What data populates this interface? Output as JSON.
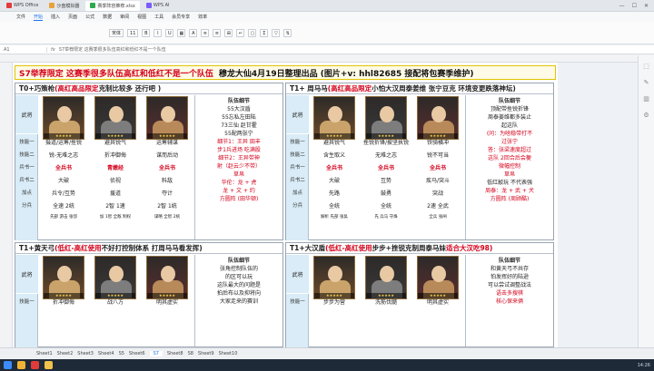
{
  "app": {
    "tabs": [
      {
        "label": "WPS Office",
        "active": false
      },
      {
        "label": "沙盘模拟器",
        "active": false
      },
      {
        "label": "赛季阵容推荐.xlsx",
        "active": true
      },
      {
        "label": "WPS AI",
        "active": false
      }
    ]
  },
  "menu": [
    "文件",
    "开始",
    "插入",
    "页面",
    "公式",
    "数据",
    "审阅",
    "视图",
    "工具",
    "会员专享",
    "效率"
  ],
  "menu_active": "开始",
  "toolbar": {
    "font": "宋体",
    "size": "11"
  },
  "formula": {
    "cellref": "A1",
    "content": "S7举荐限定 这赛季很多队伍高红和低红不是一个队伍"
  },
  "banner": {
    "part1": "S7举荐限定 这赛季很多队伍高红和低红不是一个队伍",
    "part2": "穆龙大仙4月19日整理出品  (图片+v:  hhl82685  接配将包赛季维护)"
  },
  "labels": [
    "技能一",
    "技能二",
    "兵书一",
    "兵书二",
    "加点",
    "分兵"
  ],
  "wj": "武将",
  "panels": [
    {
      "id": "tl",
      "title_a": "T0+巧策枪 ",
      "title_b": "(高红高品限定",
      "title_c": " 克制比较多 还行吧 )",
      "heroes": [
        {
          "s1": "摄道/运筹/挫锐",
          "s2": "锐-无难之志",
          "b1": "全兵书",
          "b2": "大破",
          "b3": "兵令/互势",
          "pt": "全速 2统",
          "sp": "先部 游击 张郃"
        },
        {
          "s1": "避其锐气",
          "s2": "折冲御侮",
          "b1": "青嫩经",
          "b2": "侦视",
          "b3": "援道",
          "pt": "2智 1速",
          "sp": "加 1智 全敌 制权"
        },
        {
          "s1": "运筹辅谋",
          "s2": "谋而后动",
          "b1": "全兵书",
          "b2": "料敌",
          "b3": "夺计",
          "pt": "2智 1统",
          "sp": "谋略 全智 2统"
        }
      ],
      "notes": [
        "队伍细节",
        "55大汉盾",
        "55忘私左田陆",
        "73三仙 赵甘霍",
        "55配两张宁",
        "细节1：王异 田丰",
        "步1兵进场 吃满股",
        "细节2：王异带神",
        "射（赵云少不带）",
        "草帛",
        "华伦：龙 + 虎",
        "龙 + 文 + 约",
        "方圆阵 (田华顿)"
      ]
    },
    {
      "id": "tr",
      "title_a": "T1+ 周马马",
      "title_b": "(高红高品限定",
      "title_c": " 小怕大汉周泰姜维 张宁豆克 环境变更跌落神坛)",
      "heroes": [
        {
          "s1": "避其锐气",
          "s2": "含生取义",
          "b1": "全兵书",
          "b2": "大破",
          "b3": "先路",
          "pt": "全统",
          "sp": "解析 先部 张奂"
        },
        {
          "s1": "挫锐折锋/披坚执锐",
          "s2": "无难之志",
          "b1": "全兵书",
          "b2": "互势",
          "b3": "鼓勇",
          "pt": "全统",
          "sp": "先 兵马 守烽"
        },
        {
          "s1": "铁骑横冲",
          "s2": "锐不可当",
          "b1": "全兵书",
          "b2": "疾马/突斗",
          "b3": "突战",
          "pt": "2速 全武",
          "sp": "全兵 张闸"
        }
      ],
      "notes": [
        "队伍细节",
        "顶配带挫锐折锋",
        "周泰姜维都多装止",
        "起这队",
        "(问：为啥稳带打不",
        "过张宁",
        "答：张梁速度超过",
        "这队 2回合后会梗",
        "微幅控制",
        "草帛",
        "低红敲玩 不代表强",
        "周泰：龙 + 武 + 犬",
        "方圆阵 (周顾酷)"
      ]
    },
    {
      "id": "bl",
      "title_a": "T1+黄天弓 ",
      "title_b": "(低红-高红使用",
      "title_c": " 不好打控制体系 打周马马看发挥)",
      "heroes": [
        {
          "s1": "折冲御侮",
          "s2": "",
          "b1": "",
          "b2": "",
          "b3": "",
          "pt": "",
          "sp": ""
        },
        {
          "s1": "战八方",
          "s2": "",
          "b1": "",
          "b2": "",
          "b3": "",
          "pt": "",
          "sp": ""
        },
        {
          "s1": "明其虚实",
          "s2": "",
          "b1": "",
          "b2": "",
          "b3": "",
          "pt": "",
          "sp": ""
        }
      ],
      "notes": [
        "队伍细节",
        "张角控制队伍的",
        "的区可以玩",
        "这队最大的问题是",
        "拍后布以及抑将向",
        "大家走来的赛训"
      ]
    },
    {
      "id": "br",
      "title_a": "T1+大汉盾 ",
      "title_b": "(低红-高红使用",
      "title_c": " 步步+挫锐克制周泰马妹",
      "title_d": " 适合大汉吃98)",
      "heroes": [
        {
          "s1": "步步为营",
          "s2": "",
          "b1": "",
          "b2": "",
          "b3": "",
          "pt": "",
          "sp": ""
        },
        {
          "s1": "洗筋伐髓",
          "s2": "",
          "b1": "",
          "b2": "",
          "b3": "",
          "pt": "",
          "sp": ""
        },
        {
          "s1": "明其虚实",
          "s2": "",
          "b1": "",
          "b2": "",
          "b3": "",
          "pt": "",
          "sp": ""
        }
      ],
      "notes": [
        "队伍细节",
        "和黄天弓不共存",
        "怕发挥好的陆逊",
        "可以尝试调整战法",
        "语击多搜棋",
        "核心保来俩"
      ]
    }
  ],
  "sheettabs": [
    "Sheet1",
    "Sheet2",
    "Sheet3",
    "Sheet4",
    "S5",
    "Sheet6",
    "S7",
    "Sheet8",
    "S8",
    "Sheet9",
    "Sheet10"
  ],
  "sheettab_active": "S7",
  "taskbar": {
    "clock": "14:26"
  },
  "colors": {
    "accent": "#1a73e8",
    "red": "#d4001a",
    "banner_border": "#e0c400",
    "label_bg": "#d9ecf7"
  }
}
